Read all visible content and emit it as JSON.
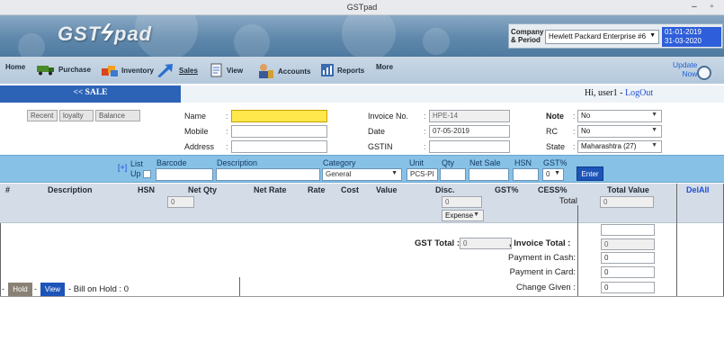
{
  "window": {
    "title": "GSTpad",
    "controls": "– ▫"
  },
  "app": {
    "logo_left": "GST",
    "logo_right": "pad"
  },
  "company": {
    "label_line1": "Company",
    "label_line2": "& Period",
    "selected": "Hewlett Packard Enterprise #6",
    "period_start": "01-01-2019",
    "period_end": "31-03-2020"
  },
  "toolbar": {
    "items": [
      "Home",
      "Purchase",
      "Inventory",
      "Sales",
      "View",
      "Accounts",
      "Reports",
      "More"
    ],
    "update_line1": "Update",
    "update_line2": "Now"
  },
  "sale": {
    "tab_label": "<< SALE",
    "greeting": "Hi, user1 - ",
    "logout": "LogOut"
  },
  "customer_buttons": [
    "Recent",
    "loyalty",
    "Balance"
  ],
  "customer": {
    "name_label": "Name",
    "mobile_label": "Mobile",
    "address_label": "Address",
    "name_value": "",
    "mobile_value": "",
    "address_value": ""
  },
  "invoice": {
    "no_label": "Invoice No.",
    "no_value": "HPE-14",
    "date_label": "Date",
    "date_value": "07-05-2019",
    "gstin_label": "GSTIN",
    "gstin_value": ""
  },
  "meta": {
    "note_label": "Note",
    "note_value": "No",
    "rc_label": "RC",
    "rc_value": "No",
    "state_label": "State",
    "state_value": "Maharashtra (27)"
  },
  "item_entry": {
    "list_label": "List",
    "up_label": "Up",
    "plus": "[+]",
    "barcode_label": "Barcode",
    "description_label": "Description",
    "category_label": "Category",
    "category_value": "General",
    "unit_label": "Unit",
    "unit_value": "PCS-PI",
    "qty_label": "Qty",
    "net_sale_label": "Net Sale",
    "hsn_label": "HSN",
    "gst_label": "GST%",
    "gst_value": "0",
    "enter_label": "Enter"
  },
  "grid": {
    "columns": [
      "#",
      "Description",
      "HSN",
      "Net Qty",
      "Net Rate",
      "Rate",
      "Cost",
      "Value",
      "Disc.",
      "GST%",
      "CESS%",
      "Total Value",
      "DelAll"
    ],
    "net_qty_total": "0",
    "disc_value": "0",
    "total_label": "Total",
    "total_value": "0",
    "expense_label": "Expense"
  },
  "totals": {
    "gst_total_label": "GST Total :",
    "gst_total_value": "0",
    "invoice_total_label": ", Invoice Total :",
    "invoice_total_value": "0",
    "payment_cash_label": "Payment in Cash:",
    "payment_cash_value": "0",
    "payment_card_label": "Payment in Card:",
    "payment_card_value": "0",
    "change_given_label": "Change Given :",
    "change_given_value": "0"
  },
  "hold": {
    "hold_label": "Hold",
    "view_label": "View",
    "status": "- Bill on Hold : 0"
  }
}
